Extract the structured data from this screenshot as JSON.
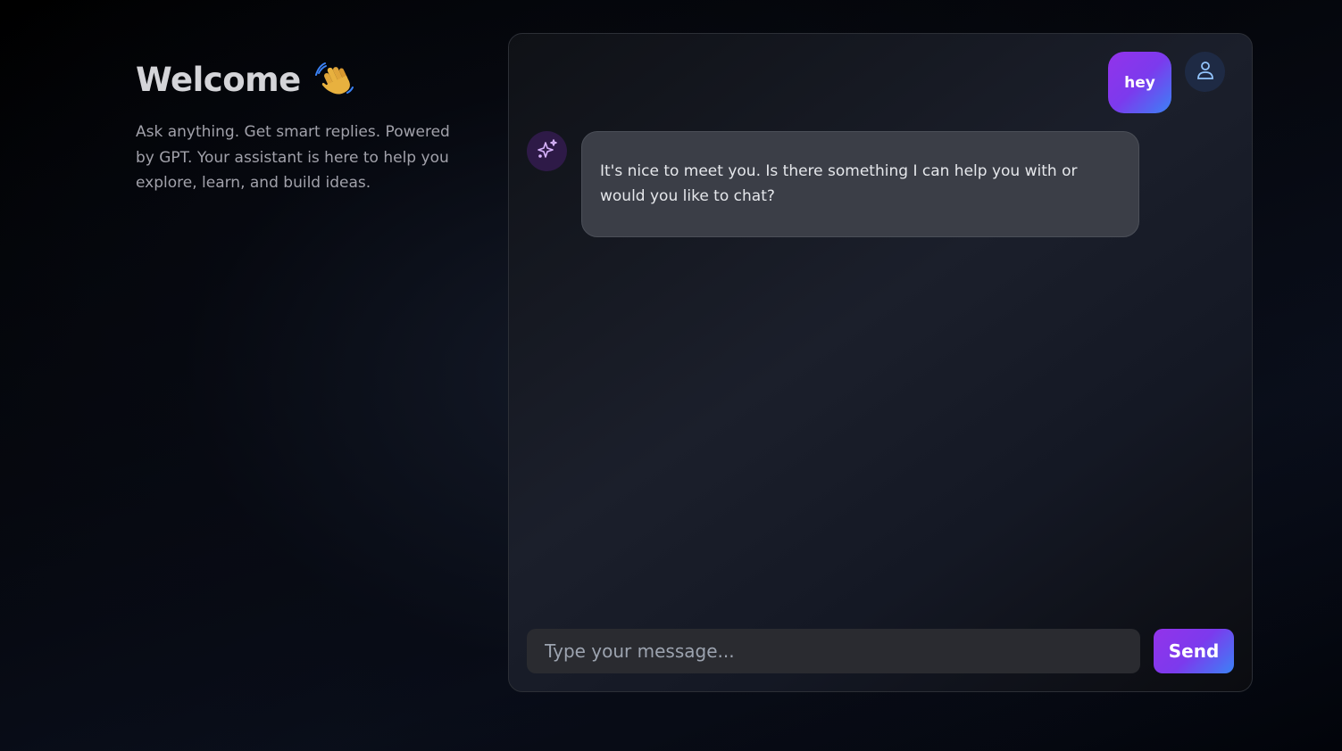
{
  "welcome": {
    "title": "Welcome",
    "wave_icon": "waving-hand-icon",
    "description": "Ask anything. Get smart replies. Powered by GPT. Your assistant is here to help you explore, learn, and build ideas."
  },
  "chat": {
    "messages": [
      {
        "role": "user",
        "text": "hey",
        "avatar_icon": "user-icon"
      },
      {
        "role": "assistant",
        "text": "It's nice to meet you. Is there something I can help you with or would you like to chat?",
        "avatar_icon": "sparkles-icon"
      }
    ],
    "composer": {
      "placeholder": "Type your message...",
      "value": "",
      "send_label": "Send"
    }
  },
  "colors": {
    "accent_gradient_start": "#9333ea",
    "accent_gradient_end": "#3b82f6",
    "assistant_bubble": "#3b3e47",
    "user_avatar_bg": "#1e2a44",
    "assistant_avatar_bg": "#2e1a47"
  }
}
